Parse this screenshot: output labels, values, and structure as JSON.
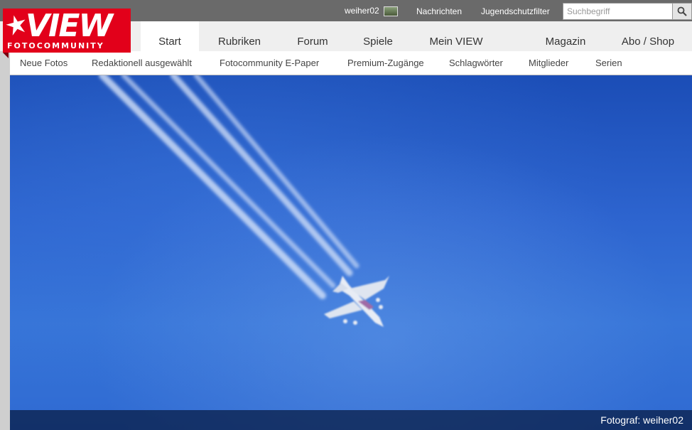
{
  "logo": {
    "word": "VIEW",
    "subtitle": "FOTOCOMMUNITY"
  },
  "topbar": {
    "username": "weiher02",
    "nachrichten": "Nachrichten",
    "jugendschutz": "Jugendschutzfilter",
    "search_placeholder": "Suchbegriff",
    "search_value": ""
  },
  "nav": {
    "items": [
      {
        "label": "Start",
        "active": true
      },
      {
        "label": "Rubriken"
      },
      {
        "label": "Forum"
      },
      {
        "label": "Spiele"
      },
      {
        "label": "Mein VIEW"
      },
      {
        "label": "Magazin"
      },
      {
        "label": "Abo / Shop"
      }
    ]
  },
  "subnav": {
    "items": [
      {
        "label": "Neue Fotos"
      },
      {
        "label": "Redaktionell ausgewählt"
      },
      {
        "label": "Fotocommunity E-Paper"
      },
      {
        "label": "Premium-Zugänge"
      },
      {
        "label": "Schlagwörter"
      },
      {
        "label": "Mitglieder"
      },
      {
        "label": "Serien"
      }
    ]
  },
  "photo": {
    "credit": "Fotograf: weiher02"
  },
  "colors": {
    "brand": "#e2001a",
    "topbar": "#6a6a6a",
    "nav": "#efefef",
    "sky": "#2d64cf"
  },
  "icons": {
    "search": "search-icon",
    "star": "star-icon",
    "avatar": "avatar"
  }
}
